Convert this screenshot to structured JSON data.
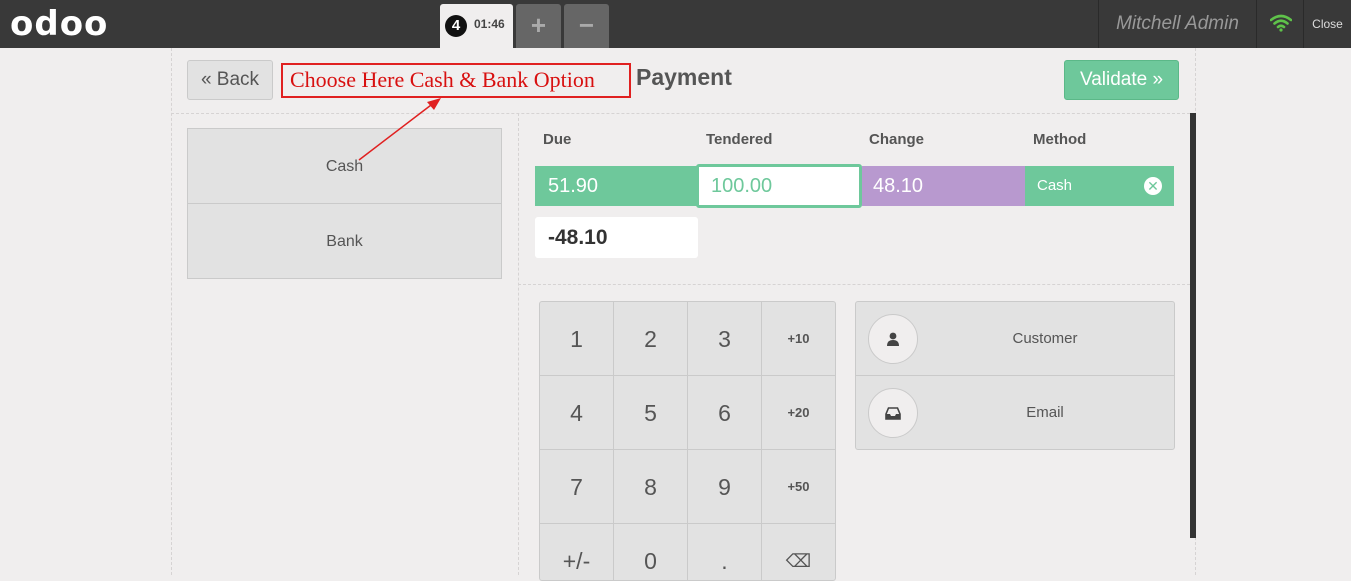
{
  "header": {
    "logo": "odoo",
    "order_number": "4",
    "order_time": "01:46",
    "add_order": "+",
    "remove_order": "−",
    "user": "Mitchell Admin",
    "close_label": "Close"
  },
  "toolbar": {
    "back_label": "« Back",
    "title": "Payment",
    "validate_label": "Validate »"
  },
  "annotation": {
    "text": "Choose  Here Cash & Bank Option",
    "color": "#d81010"
  },
  "payment_methods": [
    {
      "label": "Cash"
    },
    {
      "label": "Bank"
    }
  ],
  "paymentlines": {
    "columns": [
      "Due",
      "Tendered",
      "Change",
      "Method"
    ],
    "rows": [
      {
        "due": "51.90",
        "tendered": "100.00",
        "change": "48.10",
        "method": "Cash"
      }
    ],
    "remaining": "-48.10"
  },
  "numpad": {
    "keys": [
      "1",
      "2",
      "3",
      "+10",
      "4",
      "5",
      "6",
      "+20",
      "7",
      "8",
      "9",
      "+50",
      "+/-",
      "0",
      ".",
      "⌫"
    ]
  },
  "actions": {
    "customer_label": "Customer",
    "email_label": "Email"
  },
  "colors": {
    "accent_green": "#6ec89b",
    "change_purple": "#b899cf",
    "topbar": "#393939"
  }
}
